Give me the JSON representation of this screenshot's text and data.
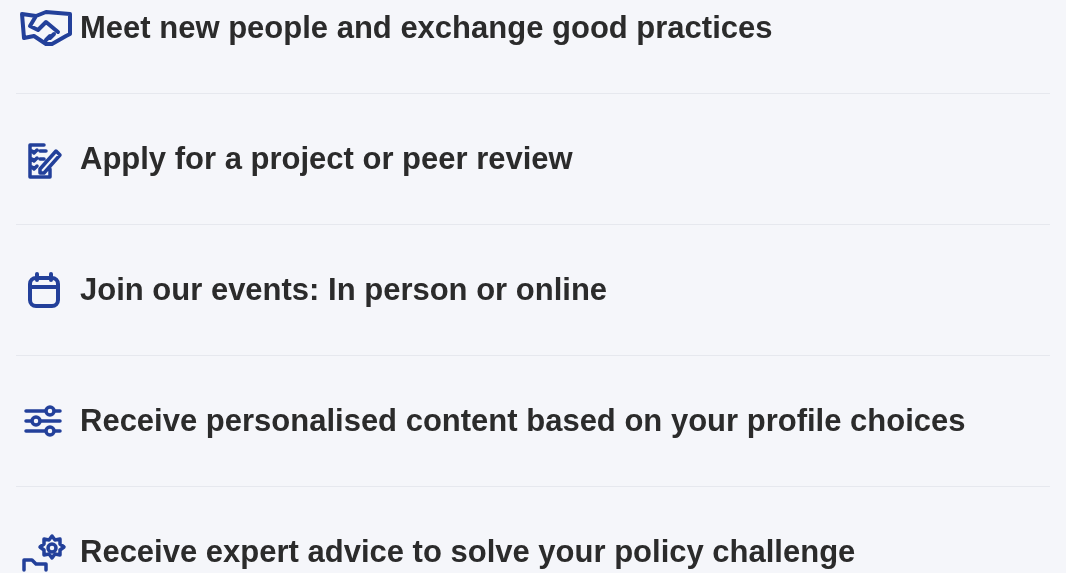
{
  "benefits": [
    {
      "kind": "handshake",
      "label": "Meet new people and exchange good practices"
    },
    {
      "kind": "form",
      "label": "Apply for a project or peer review"
    },
    {
      "kind": "calendar",
      "label": "Join our events: In person or online"
    },
    {
      "kind": "sliders",
      "label": "Receive personalised content based on your profile choices"
    },
    {
      "kind": "advice",
      "label": "Receive expert advice to solve your policy challenge"
    }
  ]
}
